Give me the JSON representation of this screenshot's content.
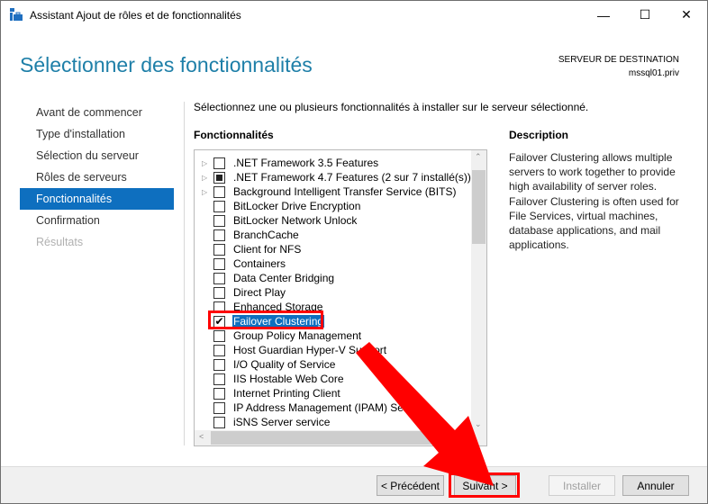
{
  "window": {
    "title": "Assistant Ajout de rôles et de fonctionnalités",
    "icon": "server-manager-icon"
  },
  "header": {
    "title": "Sélectionner des fonctionnalités",
    "destination_label": "SERVEUR DE DESTINATION",
    "destination_server": "mssql01.priv"
  },
  "sidebar": {
    "items": [
      {
        "label": "Avant de commencer",
        "state": "normal"
      },
      {
        "label": "Type d'installation",
        "state": "normal"
      },
      {
        "label": "Sélection du serveur",
        "state": "normal"
      },
      {
        "label": "Rôles de serveurs",
        "state": "normal"
      },
      {
        "label": "Fonctionnalités",
        "state": "selected"
      },
      {
        "label": "Confirmation",
        "state": "normal"
      },
      {
        "label": "Résultats",
        "state": "disabled"
      }
    ]
  },
  "main": {
    "intro": "Sélectionnez une ou plusieurs fonctionnalités à installer sur le serveur sélectionné.",
    "features_label": "Fonctionnalités",
    "description_label": "Description",
    "description": "Failover Clustering allows multiple servers to work together to provide high availability of server roles. Failover Clustering is often used for File Services, virtual machines, database applications, and mail applications.",
    "features": [
      {
        "label": ".NET Framework 3.5 Features",
        "state": "unchecked",
        "expandable": true
      },
      {
        "label": ".NET Framework 4.7 Features (2 sur 7 installé(s))",
        "state": "partial",
        "expandable": true
      },
      {
        "label": "Background Intelligent Transfer Service (BITS)",
        "state": "unchecked",
        "expandable": true
      },
      {
        "label": "BitLocker Drive Encryption",
        "state": "unchecked"
      },
      {
        "label": "BitLocker Network Unlock",
        "state": "unchecked"
      },
      {
        "label": "BranchCache",
        "state": "unchecked"
      },
      {
        "label": "Client for NFS",
        "state": "unchecked"
      },
      {
        "label": "Containers",
        "state": "unchecked"
      },
      {
        "label": "Data Center Bridging",
        "state": "unchecked"
      },
      {
        "label": "Direct Play",
        "state": "unchecked"
      },
      {
        "label": "Enhanced Storage",
        "state": "unchecked"
      },
      {
        "label": "Failover Clustering",
        "state": "checked",
        "selected": true
      },
      {
        "label": "Group Policy Management",
        "state": "unchecked"
      },
      {
        "label": "Host Guardian Hyper-V Support",
        "state": "unchecked"
      },
      {
        "label": "I/O Quality of Service",
        "state": "unchecked"
      },
      {
        "label": "IIS Hostable Web Core",
        "state": "unchecked"
      },
      {
        "label": "Internet Printing Client",
        "state": "unchecked"
      },
      {
        "label": "IP Address Management (IPAM) Server",
        "state": "unchecked"
      },
      {
        "label": "iSNS Server service",
        "state": "unchecked"
      }
    ]
  },
  "footer": {
    "previous": "< Précédent",
    "next": "Suivant >",
    "install": "Installer",
    "cancel": "Annuler"
  },
  "colors": {
    "accent": "#0e6fbf",
    "heading": "#1e7fa8",
    "annotation": "#ff0000"
  }
}
